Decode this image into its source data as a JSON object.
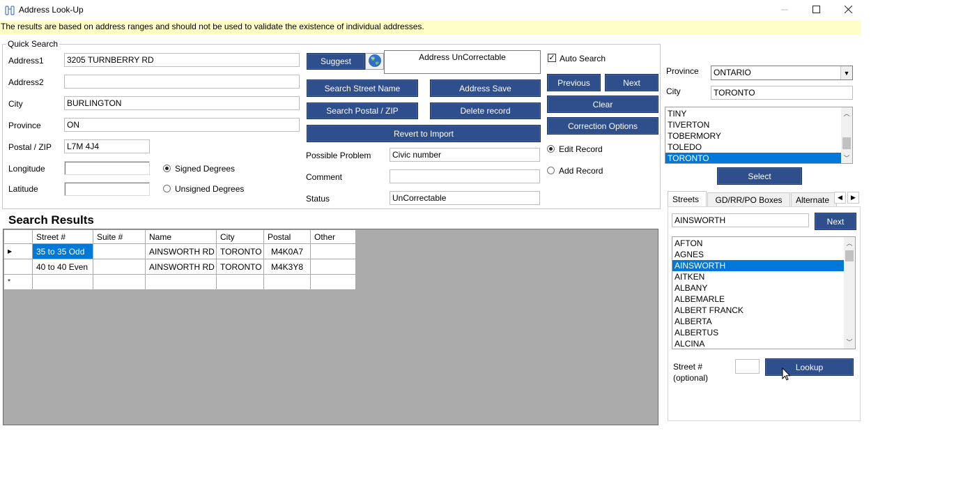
{
  "window": {
    "title": "Address Look-Up"
  },
  "notice": "The results are based on address ranges and should not be used to validate the existence of individual addresses.",
  "quick_search": {
    "legend": "Quick Search",
    "address1_label": "Address1",
    "address1_value": "3205 TURNBERRY RD",
    "address2_label": "Address2",
    "address2_value": "",
    "city_label": "City",
    "city_value": "BURLINGTON",
    "province_label": "Province",
    "province_value": "ON",
    "postal_label": "Postal / ZIP",
    "postal_value": "L7M 4J4",
    "longitude_label": "Longitude",
    "longitude_value": "",
    "latitude_label": "Latitude",
    "latitude_value": "",
    "signed_degrees": "Signed Degrees",
    "unsigned_degrees": "Unsigned Degrees",
    "suggest_button": "Suggest",
    "status_box_text": "Address UnCorrectable",
    "search_street_button": "Search Street Name",
    "address_save_button": "Address Save",
    "search_postal_button": "Search Postal / ZIP",
    "delete_record_button": "Delete record",
    "revert_button": "Revert to Import",
    "possible_problem_label": "Possible Problem",
    "possible_problem_value": "Civic number",
    "comment_label": "Comment",
    "comment_value": "",
    "status_label": "Status",
    "status_value": "UnCorrectable",
    "auto_search_label": "Auto Search",
    "auto_search_checked": true,
    "previous_button": "Previous",
    "next_button": "Next",
    "clear_button": "Clear",
    "correction_options_button": "Correction Options",
    "edit_record_label": "Edit Record",
    "add_record_label": "Add Record",
    "selected_record_mode": "Edit Record",
    "selected_degrees_mode": "Signed Degrees"
  },
  "search_results": {
    "title": "Search Results",
    "columns": [
      "Street #",
      "Suite #",
      "Name",
      "City",
      "Postal",
      "Other"
    ],
    "rows": [
      {
        "marker": "▶",
        "street": "35 to 35 Odd",
        "suite": "",
        "name": "AINSWORTH RD",
        "city": "TORONTO",
        "postal": "M4K0A7",
        "other": ""
      },
      {
        "marker": "",
        "street": "40 to 40 Even",
        "suite": "",
        "name": "AINSWORTH RD",
        "city": "TORONTO",
        "postal": "M4K3Y8",
        "other": ""
      },
      {
        "marker": "*",
        "street": "",
        "suite": "",
        "name": "",
        "city": "",
        "postal": "",
        "other": ""
      }
    ]
  },
  "right_panel": {
    "province_label": "Province",
    "province_value": "ONTARIO",
    "city_label": "City",
    "city_value": "TORONTO",
    "cities": [
      "TINY",
      "TIVERTON",
      "TOBERMORY",
      "TOLEDO",
      "TORONTO"
    ],
    "selected_city": "TORONTO",
    "select_button": "Select",
    "tabs": [
      "Streets",
      "GD/RR/PO Boxes",
      "Alternate"
    ],
    "active_tab": "Streets",
    "street_search_value": "AINSWORTH",
    "street_next_button": "Next",
    "streets": [
      "AFTON",
      "AGNES",
      "AINSWORTH",
      "AITKEN",
      "ALBANY",
      "ALBEMARLE",
      "ALBERT FRANCK",
      "ALBERTA",
      "ALBERTUS",
      "ALCINA"
    ],
    "selected_street": "AINSWORTH",
    "street_num_label": "Street #",
    "street_num_optional": "(optional)",
    "street_num_value": "",
    "lookup_button": "Lookup"
  },
  "icons": {
    "app": "binoculars-icon",
    "globe": "globe-icon",
    "minimize": "minimize-icon",
    "maximize": "maximize-icon",
    "close": "close-icon"
  },
  "colors": {
    "button_bg": "#2e4e8c",
    "selection": "#0078d7",
    "notice_bg": "#ffffc8",
    "grid_bg": "#ababab"
  }
}
